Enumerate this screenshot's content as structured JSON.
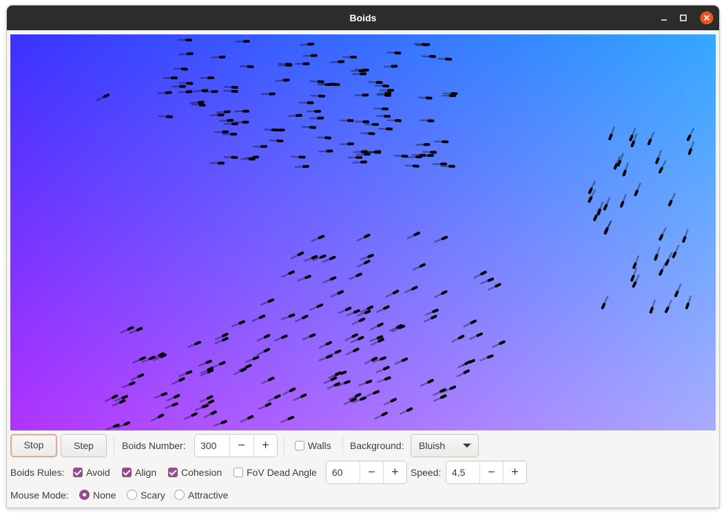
{
  "window": {
    "title": "Boids",
    "controls": {
      "minimize_icon": "minimize-icon",
      "maximize_icon": "maximize-icon",
      "close_icon": "close-icon"
    },
    "close_color": "#e95420"
  },
  "canvas": {
    "background_gradient": {
      "top_left": "#3a33ff",
      "top_right": "#33a8ff",
      "bottom_left": "#b233ff",
      "bottom_right": "#a9acff"
    }
  },
  "row1": {
    "stop_label": "Stop",
    "step_label": "Step",
    "boids_number_label": "Boids Number:",
    "boids_number_value": "300",
    "minus": "−",
    "plus": "+",
    "walls_label": "Walls",
    "walls_checked": false,
    "background_label": "Background:",
    "background_value": "Bluish"
  },
  "row2": {
    "rules_label": "Boids Rules:",
    "avoid_label": "Avoid",
    "avoid_checked": true,
    "align_label": "Align",
    "align_checked": true,
    "cohesion_label": "Cohesion",
    "cohesion_checked": true,
    "fov_label": "FoV Dead Angle",
    "fov_checked": false,
    "fov_value": "60",
    "speed_label": "Speed:",
    "speed_value": "4,5",
    "minus": "−",
    "plus": "+"
  },
  "row3": {
    "mouse_mode_label": "Mouse Mode:",
    "none_label": "None",
    "scary_label": "Scary",
    "attractive_label": "Attractive",
    "selected": "None"
  },
  "accent_color": "#924d8b"
}
